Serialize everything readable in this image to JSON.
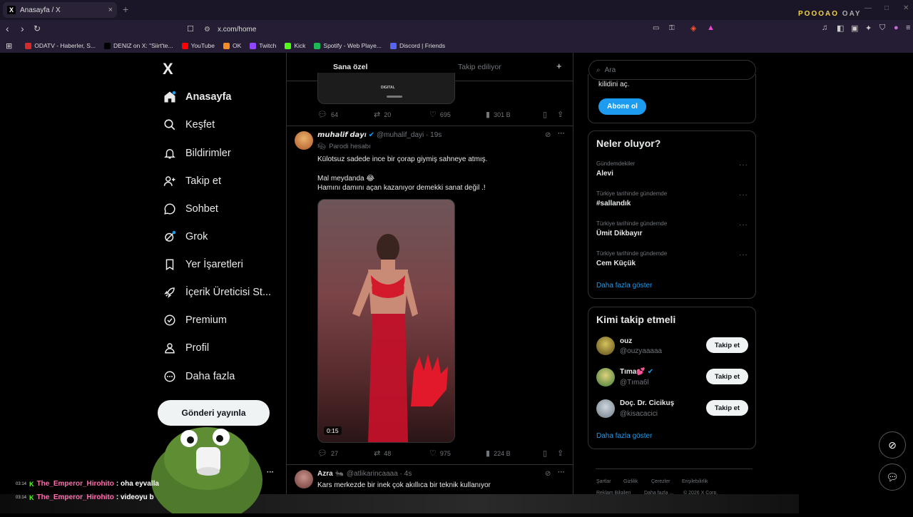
{
  "browser": {
    "tab_title": "Anasayfa / X",
    "tab_close": "×",
    "new_tab": "+",
    "url": "x.com/home",
    "watermark_main": "POOOAO ",
    "watermark_dim": "OAY",
    "bookmarks": [
      {
        "label": "ODATV - Haberler, S...",
        "color": "#d32b2b"
      },
      {
        "label": "DENIZ on X: \"Siirt'te...",
        "color": "#000000"
      },
      {
        "label": "YouTube",
        "color": "#ff0000"
      },
      {
        "label": "OK",
        "color": "#f28c28"
      },
      {
        "label": "Twitch",
        "color": "#9146ff"
      },
      {
        "label": "Kick",
        "color": "#53fc18"
      },
      {
        "label": "Spotify - Web Playe...",
        "color": "#1db954"
      },
      {
        "label": "Discord | Friends",
        "color": "#5865f2"
      }
    ]
  },
  "nav": {
    "logo": "X",
    "items": [
      {
        "label": "Anasayfa",
        "icon": "home-icon"
      },
      {
        "label": "Keşfet",
        "icon": "search-icon"
      },
      {
        "label": "Bildirimler",
        "icon": "bell-icon"
      },
      {
        "label": "Takip et",
        "icon": "add-user-icon"
      },
      {
        "label": "Sohbet",
        "icon": "chat-icon"
      },
      {
        "label": "Grok",
        "icon": "grok-icon"
      },
      {
        "label": "Yer İşaretleri",
        "icon": "bookmark-icon"
      },
      {
        "label": "İçerik Üreticisi St...",
        "icon": "rocket-icon"
      },
      {
        "label": "Premium",
        "icon": "verified-icon"
      },
      {
        "label": "Profil",
        "icon": "person-icon"
      },
      {
        "label": "Daha fazla",
        "icon": "more-circle-icon"
      }
    ],
    "post_button": "Gönderi yayınla",
    "more_dots": "···"
  },
  "timeline": {
    "tabs": [
      "Sana özel",
      "Takip ediliyor"
    ],
    "add_tab": "+",
    "prev_post": {
      "media_label": "DIGITAL",
      "replies": "64",
      "reposts": "20",
      "likes": "695",
      "views": "301 B"
    },
    "post1": {
      "name": "𝙢𝙪𝙝𝙖𝙡𝙞𝙛 𝙙𝙖𝙮ı",
      "handle": "@muhalif_dayi · 19s",
      "parody": "Parodi hesabı",
      "line1": "Külotsuz sadede ince bir çorap giymiş sahneye atmış.",
      "line2": "Mal meydanda 😂",
      "line3": "Hamını damını açan kazanıyor demekki sanat değil .!",
      "video_time": "0:15",
      "replies": "27",
      "reposts": "48",
      "likes": "975",
      "views": "224 B"
    },
    "post2": {
      "name": "Azra 🐜",
      "handle": "@atlikarincaaaa · 4s",
      "text": "Kars merkezde bir inek çok akıllıca bir teknik kullanıyor"
    }
  },
  "right": {
    "search_placeholder": "Ara",
    "subscribe_text": "kilidini aç.",
    "subscribe_button": "Abone ol",
    "trends_title": "Neler oluyor?",
    "trends": [
      {
        "meta": "Gündemdekiler",
        "name": "Alevi"
      },
      {
        "meta": "Türkiye tarihinde gündemde",
        "name": "#sallandık"
      },
      {
        "meta": "Türkiye tarihinde gündemde",
        "name": "Ümit Dikbayır"
      },
      {
        "meta": "Türkiye tarihinde gündemde",
        "name": "Cem Küçük"
      }
    ],
    "show_more": "Daha fazla göster",
    "who_title": "Kimi takip etmeli",
    "who": [
      {
        "name": "ouz",
        "handle": "@ouzyaaaaa",
        "button": "Takip et"
      },
      {
        "name": "Tıma💕",
        "handle": "@Tıma6l",
        "button": "Takip et"
      },
      {
        "name": "Doç. Dr. Cicikuş",
        "handle": "@kisacacici",
        "button": "Takip et"
      }
    ],
    "who_more": "Daha fazla göster",
    "footer": [
      "Şartlar",
      "Gizlilik",
      "Çerezler",
      "Erişilebilirlik",
      "Reklam Bilgileri",
      "Daha fazla ...",
      "© 2026 X Corp."
    ]
  },
  "chat": [
    {
      "time": "03:14",
      "user": "The_Emperor_Hirohito",
      "msg": ": oha eyvalla"
    },
    {
      "time": "03:14",
      "user": "The_Emperor_Hirohito",
      "msg": ": videoyu b"
    }
  ]
}
